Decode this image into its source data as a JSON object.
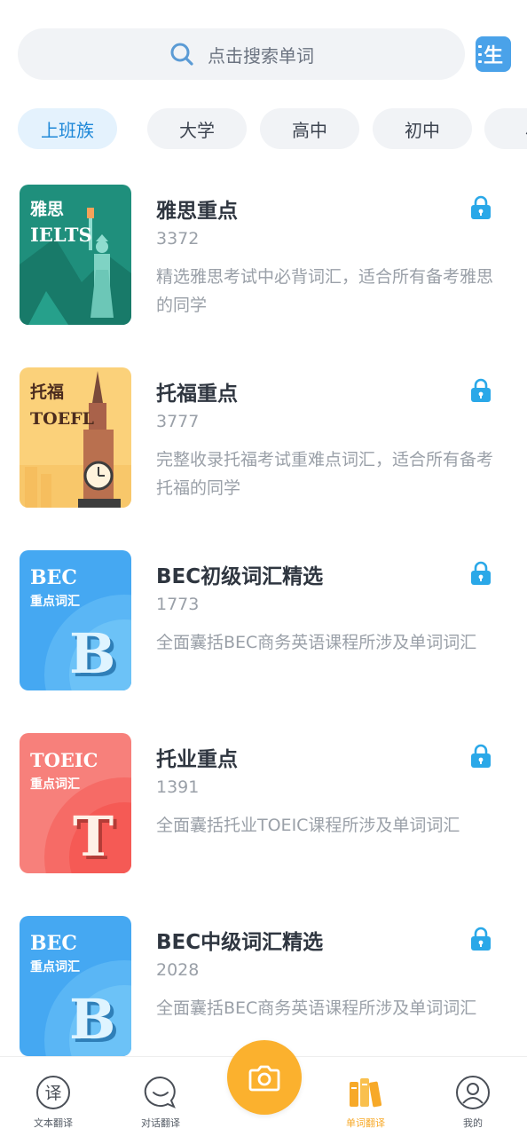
{
  "search": {
    "placeholder": "点击搜索单词",
    "vocab_badge": "生"
  },
  "tabs": [
    {
      "label": "上班族",
      "active": true
    },
    {
      "label": "大学",
      "active": false
    },
    {
      "label": "高中",
      "active": false
    },
    {
      "label": "初中",
      "active": false
    },
    {
      "label": "小",
      "active": false
    }
  ],
  "books": [
    {
      "title": "雅思重点",
      "count": "3372",
      "desc": "精选雅思考试中必背词汇，适合所有备考雅思的同学",
      "cover": {
        "line1": "雅思",
        "line2": "IELTS",
        "bg": "#1f8f7c"
      }
    },
    {
      "title": "托福重点",
      "count": "3777",
      "desc": "完整收录托福考试重难点词汇，适合所有备考托福的同学",
      "cover": {
        "line1": "托福",
        "line2": "TOEFL",
        "bg": "#fbd17a"
      }
    },
    {
      "title": "BEC初级词汇精选",
      "count": "1773",
      "desc": "全面囊括BEC商务英语课程所涉及单词词汇",
      "cover": {
        "line1": "BEC",
        "line2": "重点词汇",
        "letter": "B",
        "bg": "#45a8f2"
      }
    },
    {
      "title": "托业重点",
      "count": "1391",
      "desc": "全面囊括托业TOEIC课程所涉及单词词汇",
      "cover": {
        "line1": "TOEIC",
        "line2": "重点词汇",
        "letter": "T",
        "bg": "#f7807b"
      }
    },
    {
      "title": "BEC中级词汇精选",
      "count": "2028",
      "desc": "全面囊括BEC商务英语课程所涉及单词词汇",
      "cover": {
        "line1": "BEC",
        "line2": "重点词汇",
        "letter": "B",
        "bg": "#45a8f2"
      }
    }
  ],
  "nav": [
    {
      "label": "文本翻译",
      "icon": "translate-icon",
      "glyph": "译",
      "active": false
    },
    {
      "label": "对话翻译",
      "icon": "chat-icon",
      "active": false
    },
    {
      "label": "单词翻译",
      "icon": "books-icon",
      "active": true
    },
    {
      "label": "我的",
      "icon": "profile-icon",
      "active": false
    }
  ],
  "camera": {
    "icon": "camera-icon"
  },
  "colors": {
    "accent_blue": "#1e88d8",
    "accent_orange": "#fbb12e",
    "lock_blue": "#2aa8e8"
  }
}
